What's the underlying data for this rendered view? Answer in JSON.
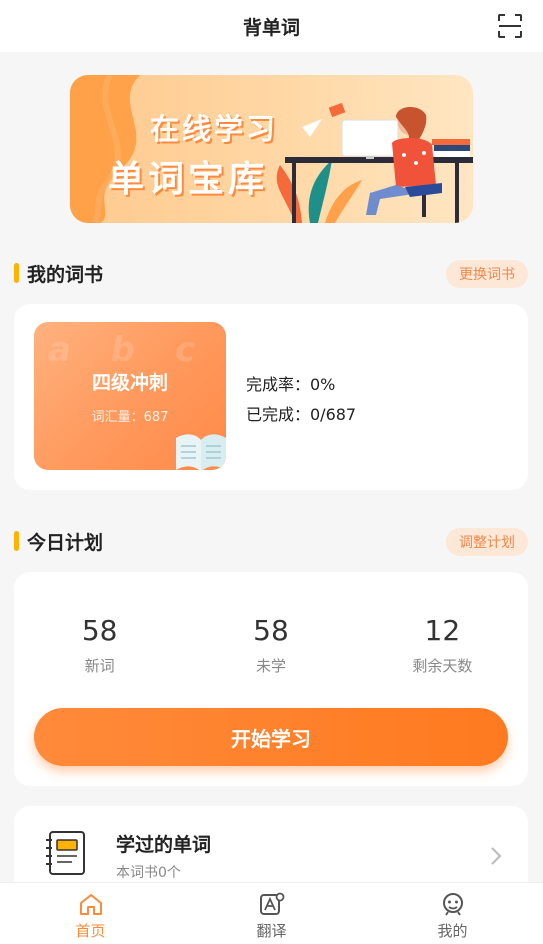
{
  "header": {
    "title": "背单词",
    "scan_icon": "scan-icon"
  },
  "banner": {
    "line1": "在线学习",
    "line2": "单词宝库"
  },
  "my_book": {
    "section_title": "我的词书",
    "change_label": "更换词书",
    "book_name": "四级冲刺",
    "vocab_label": "词汇量：687",
    "cover_letters": "a b c",
    "completion_rate": "完成率：0%",
    "completed": "已完成：0/687"
  },
  "today_plan": {
    "section_title": "今日计划",
    "adjust_label": "调整计划",
    "stats": [
      {
        "value": "58",
        "label": "新词"
      },
      {
        "value": "58",
        "label": "未学"
      },
      {
        "value": "12",
        "label": "剩余天数"
      }
    ],
    "start_label": "开始学习"
  },
  "learned": {
    "title": "学过的单词",
    "subtitle": "本词书0个"
  },
  "bottom_nav": {
    "items": [
      {
        "label": "首页",
        "icon": "home-icon",
        "active": true
      },
      {
        "label": "翻译",
        "icon": "translate-icon",
        "active": false
      },
      {
        "label": "我的",
        "icon": "profile-icon",
        "active": false
      }
    ]
  },
  "colors": {
    "accent": "#ff7a1f",
    "section_bar": "#ffb300",
    "pill_bg": "#fde7d7",
    "pill_text": "#f08a4b"
  }
}
